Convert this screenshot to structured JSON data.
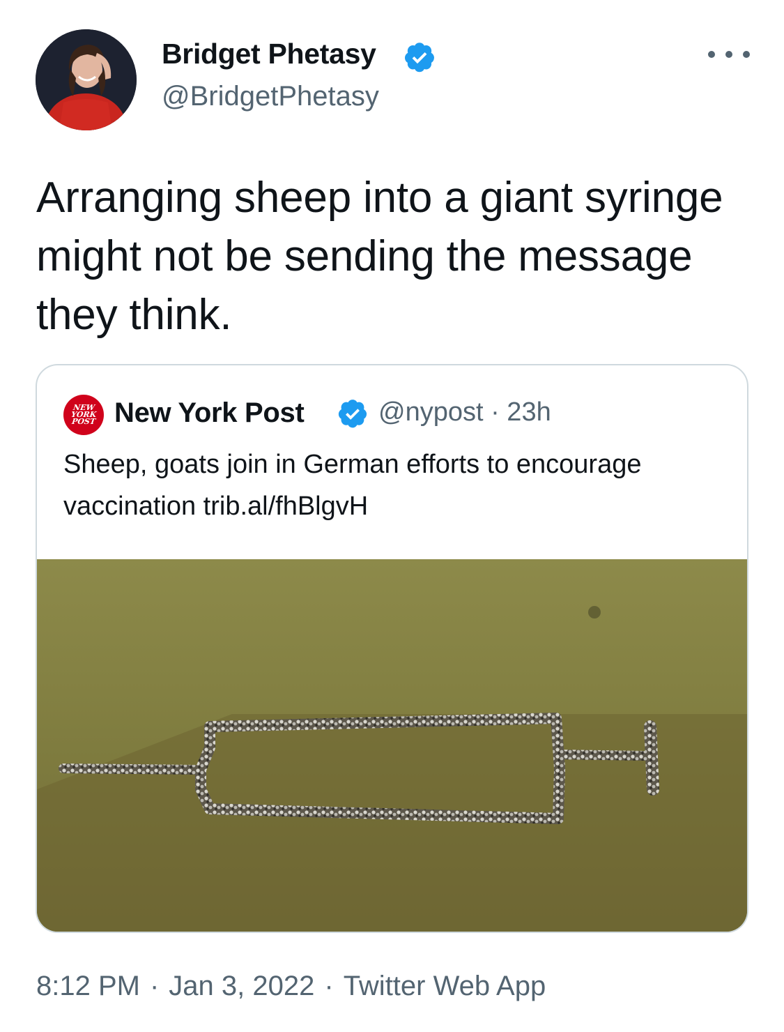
{
  "tweet": {
    "author": {
      "name": "Bridget Phetasy",
      "handle": "@BridgetPhetasy",
      "verified": true
    },
    "text": "Arranging sheep into a giant syringe might not be sending the message they think.",
    "quoted": {
      "avatar_lines": [
        "NEW",
        "YORK",
        "POST"
      ],
      "author": "New York Post",
      "verified": true,
      "meta": "@nypost · 23h",
      "text": "Sheep, goats join in German efforts to encourage vaccination trib.al/fhBlgvH"
    },
    "timestamp": {
      "time": "8:12 PM",
      "date": "Jan 3, 2022",
      "source": "Twitter Web App",
      "separator": "·"
    }
  },
  "colors": {
    "text_primary": "#0f1419",
    "text_secondary": "#536471",
    "verified_blue": "#1d9bf0",
    "card_border": "#cfd9de",
    "nypost_red": "#d0021b"
  }
}
